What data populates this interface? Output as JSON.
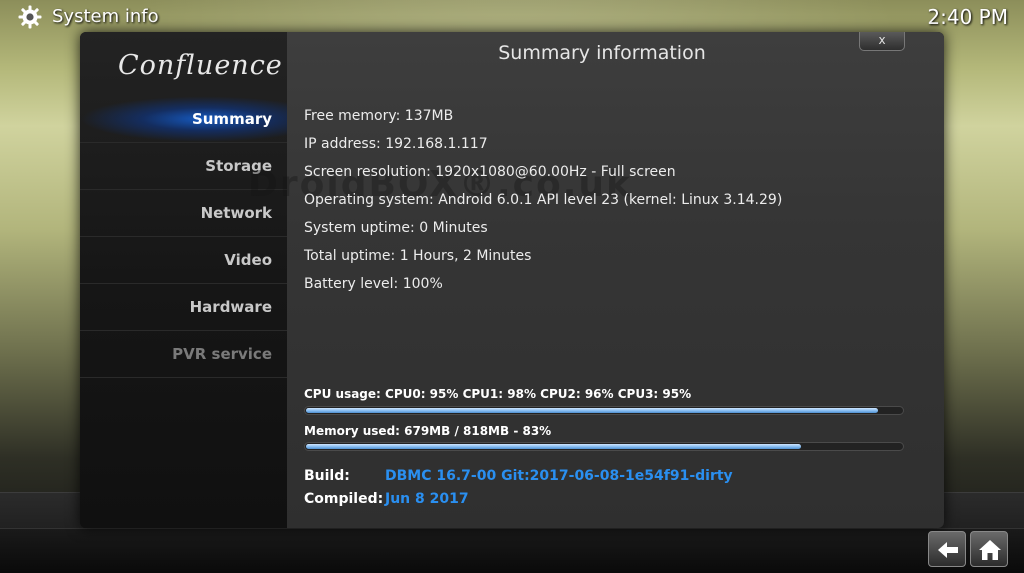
{
  "topbar": {
    "title": "System info",
    "clock": "2:40 PM"
  },
  "dialog": {
    "logo": "Confluence",
    "title": "Summary information",
    "close_label": "x"
  },
  "sidebar": {
    "items": [
      {
        "label": "Summary",
        "state": "active"
      },
      {
        "label": "Storage",
        "state": "normal"
      },
      {
        "label": "Network",
        "state": "normal"
      },
      {
        "label": "Video",
        "state": "normal"
      },
      {
        "label": "Hardware",
        "state": "normal"
      },
      {
        "label": "PVR service",
        "state": "disabled"
      }
    ]
  },
  "summary": {
    "lines": [
      "Free memory: 137MB",
      "IP address: 192.168.1.117",
      "Screen resolution: 1920x1080@60.00Hz - Full screen",
      "Operating system: Android 6.0.1 API level 23 (kernel: Linux 3.14.29)",
      "System uptime: 0 Minutes",
      "Total uptime: 1 Hours, 2 Minutes",
      "Battery level: 100%"
    ]
  },
  "watermark": "DroidBOX®.co.uk",
  "meters": {
    "cpu": {
      "label": "CPU usage: CPU0:  95% CPU1:  98% CPU2:  96% CPU3:  95%",
      "percent": 96
    },
    "memory": {
      "label": "Memory used: 679MB / 818MB - 83%",
      "percent": 83
    }
  },
  "build": {
    "build_key": "Build:",
    "build_value": "DBMC 16.7-00 Git:2017-06-08-1e54f91-dirty",
    "compiled_key": "Compiled:",
    "compiled_value": "Jun  8 2017"
  },
  "colors": {
    "accent_blue": "#2a8ff0",
    "bar_fill": "#7fb7ee"
  },
  "icons": {
    "settings": "gear-icon",
    "back": "back-arrow-icon",
    "home": "home-icon"
  }
}
